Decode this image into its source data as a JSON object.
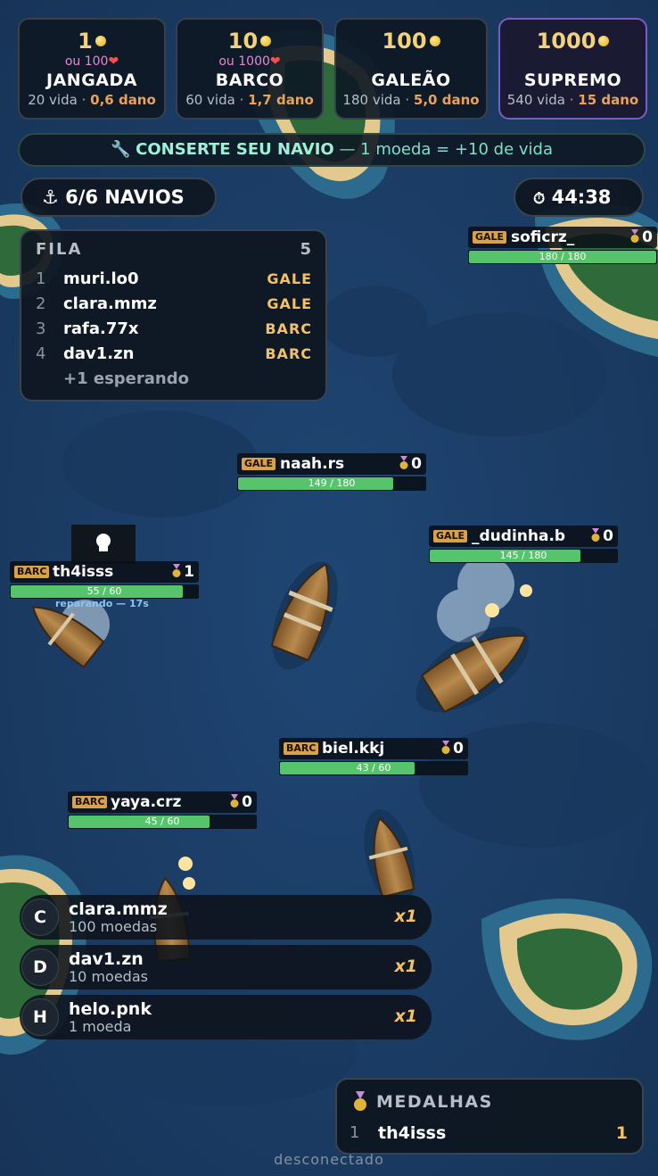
{
  "shop": [
    {
      "price": "1",
      "alt": "ou 100",
      "name": "JANGADA",
      "hp": "20 vida",
      "dmg": "0,6 dano"
    },
    {
      "price": "10",
      "alt": "ou 1000",
      "name": "BARCO",
      "hp": "60 vida",
      "dmg": "1,7 dano"
    },
    {
      "price": "100",
      "alt": "",
      "name": "GALEÃO",
      "hp": "180 vida",
      "dmg": "5,0 dano"
    },
    {
      "price": "1000",
      "alt": "",
      "name": "SUPREMO",
      "hp": "540 vida",
      "dmg": "15 dano"
    }
  ],
  "repair": {
    "title": "CONSERTE SEU NAVIO",
    "detail": "— 1 moeda = +10 de vida"
  },
  "ships_count": "6/6 NAVIOS",
  "timer": "44:38",
  "queue": {
    "title": "FILA",
    "count": "5",
    "rows": [
      {
        "n": "1",
        "user": "muri.lo0",
        "type": "GALE"
      },
      {
        "n": "2",
        "user": "clara.mmz",
        "type": "GALE"
      },
      {
        "n": "3",
        "user": "rafa.77x",
        "type": "BARC"
      },
      {
        "n": "4",
        "user": "dav1.zn",
        "type": "BARC"
      }
    ],
    "waiting": "+1 esperando"
  },
  "players": [
    {
      "badge": "GALE",
      "name": "soficrz_",
      "medals": "0",
      "hp_text": "180 / 180",
      "hp_fraction": 1.0
    },
    {
      "badge": "GALE",
      "name": "naah.rs",
      "medals": "0",
      "hp_text": "149 / 180",
      "hp_fraction": 0.828
    },
    {
      "badge": "GALE",
      "name": "_dudinha.b",
      "medals": "0",
      "hp_text": "145 / 180",
      "hp_fraction": 0.806
    },
    {
      "badge": "BARC",
      "name": "th4isss",
      "medals": "1",
      "hp_text": "55 / 60",
      "hp_fraction": 0.917,
      "status": "reparando — 17s"
    },
    {
      "badge": "BARC",
      "name": "biel.kkj",
      "medals": "0",
      "hp_text": "43 / 60",
      "hp_fraction": 0.717
    },
    {
      "badge": "BARC",
      "name": "yaya.crz",
      "medals": "0",
      "hp_text": "45 / 60",
      "hp_fraction": 0.75
    }
  ],
  "donors": [
    {
      "initial": "C",
      "name": "clara.mmz",
      "coins": "100 moedas",
      "mult": "x1"
    },
    {
      "initial": "D",
      "name": "dav1.zn",
      "coins": "10 moedas",
      "mult": "x1"
    },
    {
      "initial": "H",
      "name": "helo.pnk",
      "coins": "1 moeda",
      "mult": "x1"
    }
  ],
  "medals": {
    "title": "MEDALHAS",
    "rows": [
      {
        "n": "1",
        "user": "th4isss",
        "value": "1"
      }
    ]
  },
  "status": "desconectado",
  "colors": {
    "gold": "#f3c266",
    "hp": "#55c46a",
    "badge": "#d9a24a",
    "repair": "#7fe0c8",
    "supremo_border": "#7d5bc4"
  }
}
